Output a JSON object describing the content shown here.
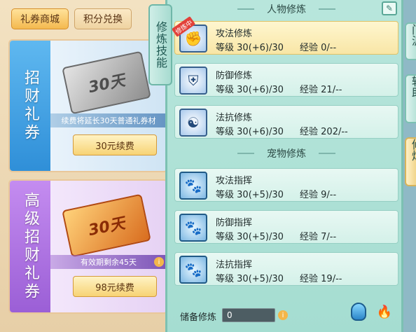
{
  "shop": {
    "tabs": [
      {
        "label": "礼券商城",
        "active": true
      },
      {
        "label": "积分兑换",
        "active": false
      }
    ],
    "cards": [
      {
        "title": "招财礼券",
        "ticket_text": "30天",
        "note": "续费将延长30天普通礼券材",
        "button": "30元续费"
      },
      {
        "title": "高级招财礼券",
        "ticket_text": "30天",
        "note": "有效期剩余45天",
        "button": "98元续费"
      }
    ]
  },
  "vertical_tab": "修炼技能",
  "panel": {
    "sections": [
      {
        "title": "人物修炼",
        "skills": [
          {
            "name": "攻法修炼",
            "level_label": "等级",
            "level": "30(+6)/30",
            "exp_label": "经验",
            "exp": "0/--",
            "active": true,
            "badge": "修炼中",
            "icon": "fist-icon"
          },
          {
            "name": "防御修炼",
            "level_label": "等级",
            "level": "30(+6)/30",
            "exp_label": "经验",
            "exp": "21/--",
            "active": false,
            "icon": "shield-icon"
          },
          {
            "name": "法抗修炼",
            "level_label": "等级",
            "level": "30(+6)/30",
            "exp_label": "经验",
            "exp": "202/--",
            "active": false,
            "icon": "yin-yang-icon"
          }
        ]
      },
      {
        "title": "宠物修炼",
        "skills": [
          {
            "name": "攻法指挥",
            "level_label": "等级",
            "level": "30(+5)/30",
            "exp_label": "经验",
            "exp": "9/--",
            "icon": "paw-attack-icon"
          },
          {
            "name": "防御指挥",
            "level_label": "等级",
            "level": "30(+5)/30",
            "exp_label": "经验",
            "exp": "7/--",
            "icon": "paw-defense-icon"
          },
          {
            "name": "法抗指挥",
            "level_label": "等级",
            "level": "30(+5)/30",
            "exp_label": "经验",
            "exp": "19/--",
            "icon": "paw-resist-icon"
          }
        ]
      }
    ],
    "reserve": {
      "label": "储备修炼",
      "value": "0"
    }
  },
  "right_tabs": [
    {
      "label": "门派",
      "active": false
    },
    {
      "label": "辅助",
      "active": false
    },
    {
      "label": "修炼",
      "active": true
    }
  ],
  "colors": {
    "panel_bg": "#b8e6dc",
    "active_skill": "#fff6cf",
    "badge": "#e2413a"
  }
}
